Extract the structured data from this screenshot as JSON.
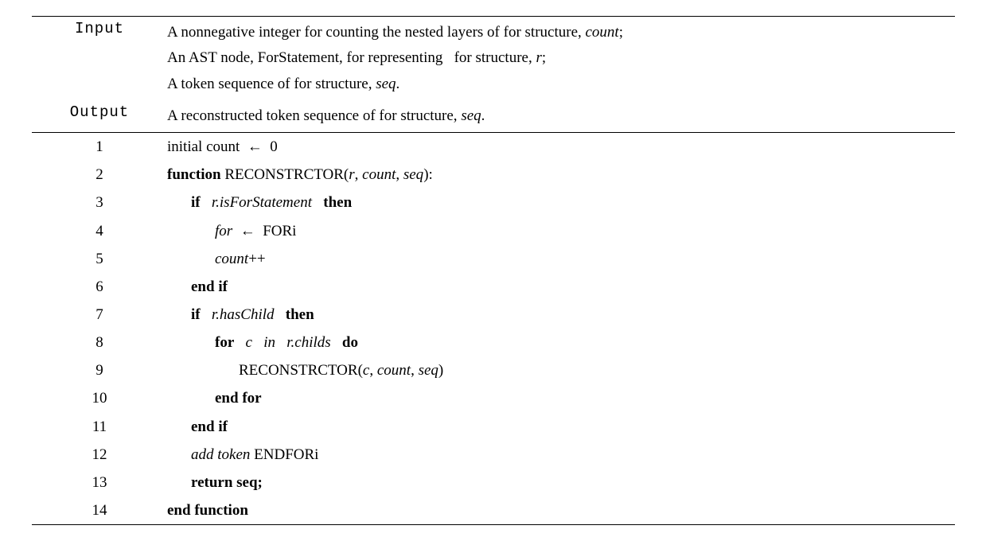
{
  "header": {
    "input_label": "Input",
    "output_label": "Output",
    "input_lines": [
      "A nonnegative integer for counting the nested layers of for structure, <span class='i'>count</span>;",
      "An AST node, ForStatement, for representing&nbsp;&nbsp;&nbsp;for structure, <span class='i'>r</span>;",
      "A token sequence of for structure, <span class='i'>seq</span>."
    ],
    "output_line": "A reconstructed token sequence of for structure, <span class='i'>seq</span>."
  },
  "lines": [
    {
      "n": "1",
      "indent": "",
      "html": "initial count&nbsp;&nbsp;←&nbsp;&nbsp;0"
    },
    {
      "n": "2",
      "indent": "",
      "html": "<span class='b'>function</span> RECONSTRCTOR(<span class='i'>r</span>, <span class='i'>count</span>, <span class='i'>seq</span>):"
    },
    {
      "n": "3",
      "indent": "ind1",
      "html": "<span class='b'>if</span>&nbsp;&nbsp;&nbsp;<span class='i'>r.isForStatement</span>&nbsp;&nbsp;&nbsp;<span class='b'>then</span>"
    },
    {
      "n": "4",
      "indent": "ind2",
      "html": "<span class='i'>for</span>&nbsp;&nbsp;←&nbsp;&nbsp;FORi"
    },
    {
      "n": "5",
      "indent": "ind2",
      "html": "<span class='i'>count</span>++"
    },
    {
      "n": "6",
      "indent": "ind1",
      "html": "<span class='b'>end if</span>"
    },
    {
      "n": "7",
      "indent": "ind1",
      "html": "<span class='b'>if</span>&nbsp;&nbsp;&nbsp;<span class='i'>r.hasChild</span>&nbsp;&nbsp;&nbsp;<span class='b'>then</span>"
    },
    {
      "n": "8",
      "indent": "ind2",
      "html": "<span class='b'>for</span>&nbsp;&nbsp;&nbsp;<span class='i'>c</span>&nbsp;&nbsp;&nbsp;<span class='i'>in</span>&nbsp;&nbsp;&nbsp;<span class='i'>r.childs</span>&nbsp;&nbsp;&nbsp;<span class='b'>do</span>"
    },
    {
      "n": "9",
      "indent": "ind3",
      "html": "RECONSTRCTOR(<span class='i'>c</span>, <span class='i'>count</span>, <span class='i'>seq</span>)"
    },
    {
      "n": "10",
      "indent": "ind2",
      "html": "<span class='b'>end for</span>"
    },
    {
      "n": "11",
      "indent": "ind1",
      "html": "<span class='b'>end if</span>"
    },
    {
      "n": "12",
      "indent": "ind1",
      "html": "<span class='i'>add token</span> ENDFORi"
    },
    {
      "n": "13",
      "indent": "ind1",
      "html": "<span class='b'>return seq;</span>"
    },
    {
      "n": "14",
      "indent": "",
      "html": "<span class='b'>end function</span>"
    }
  ]
}
